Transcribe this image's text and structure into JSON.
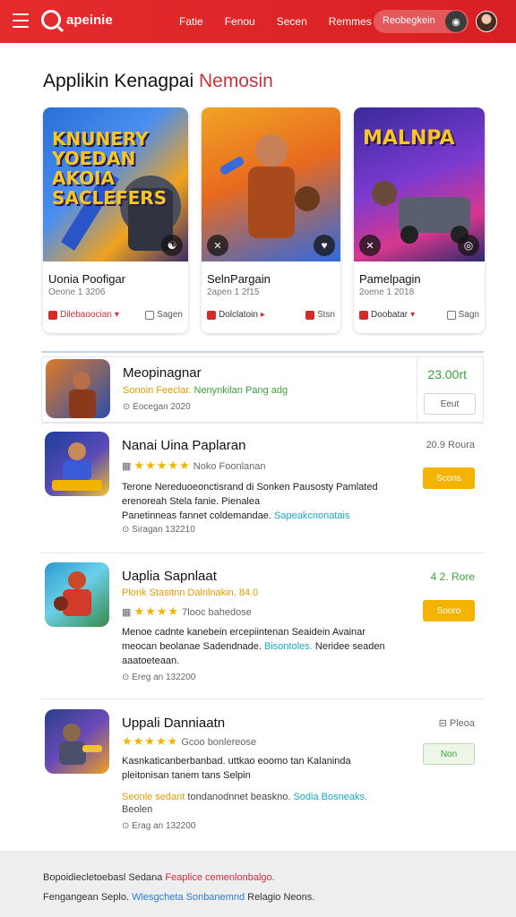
{
  "header": {
    "logo_text": "apeinie",
    "nav": [
      "Fatie",
      "Fenou",
      "Secen",
      "Remmes"
    ],
    "search_label": "Reobegkein",
    "search_icon": "chat-bubble-icon",
    "brand_color": "#e52b2b"
  },
  "section": {
    "title_main": "Applikin Kenagpai",
    "title_accent": "Nemosin"
  },
  "featured": [
    {
      "art_text": "KNUNERY YOEDAN AKOIA SACLEFERS",
      "title": "Uonia Poofigar",
      "subtitle": "Oeone 1 3206",
      "store": "Dilebaoocian",
      "save": "Sagen",
      "colors": [
        "#2a6fd6",
        "#f0a21f"
      ]
    },
    {
      "art_text": "",
      "title": "SelnPargain",
      "subtitle": "2apen 1 2f15",
      "store": "Dolclatoin",
      "save": "Stsn",
      "colors": [
        "#f08a24",
        "#3b6ed8"
      ]
    },
    {
      "art_text": "MALNPA",
      "title": "Pamelpagin",
      "subtitle": "2oene 1 2018",
      "store": "Doobatar",
      "save": "Sagn",
      "colors": [
        "#5a2ab8",
        "#d8378f"
      ]
    }
  ],
  "list": [
    {
      "title": "Meopinagnar",
      "meta_orange": "Sonoin Feeclar.",
      "meta_green": "Nenynkilan Pang adg",
      "footer": "Eocegan 2020",
      "price": "23.00rt",
      "button": "Eeut",
      "colors": [
        "#e07a2a",
        "#2a4fa8"
      ]
    },
    {
      "title": "Nanai Uina Paplaran",
      "stars": "★★★★★",
      "rating_text": "Noko Foonlanan",
      "desc_1": "Terone Nereduoeonctisrand di Sonken Pausosty Pamlated",
      "desc_2": "erenoreah Stela fanie. Pienalea",
      "desc_3": "Panetinneas fannet coldemandae.",
      "desc_link": "Sapeakcnonatais",
      "footer": "Siragan 132210",
      "price": "20.9 Roura",
      "button": "Scons",
      "colors": [
        "#1c3f9a",
        "#f2c230"
      ]
    },
    {
      "title": "Uaplia Sapnlaat",
      "meta_orange": "Plonk Stasitnn Dalnlnakin. 84.0",
      "stars": "★★★★",
      "rating_text": "7looc bahedose",
      "desc_1": "Menoe cadnte kanebein ercepiintenan Seaidein Avainar",
      "desc_2": "meocan beolanae Sadendnade.",
      "desc_link": "Bisontoles.",
      "desc_2b": "Neridee seaden",
      "desc_3": "aaatoeteaan.",
      "footer": "Ereg an 132200",
      "price": "4 2. Rore",
      "button": "Sooro",
      "colors": [
        "#2a9ad0",
        "#d23a2a"
      ]
    },
    {
      "title": "Uppali Danniaatn",
      "stars": "★★★★★",
      "rating_text": "Gcoo bonlereose",
      "desc_1": "Kasnkaticanberbanbad. uttkao eoomo tan Kalaninda",
      "desc_2": "pleitonisan tanem tans Selpin",
      "meta_orange": "Seonle sedant",
      "meta_grey": "tondanodnnet beaskno.",
      "desc_link": "Sodia Bosneaks.",
      "footer_top": "Beolen",
      "footer": "Erag an 132200",
      "price": "Pleoa",
      "button": "Non",
      "colors": [
        "#2a3f8a",
        "#f0a020"
      ]
    }
  ],
  "footer": {
    "line1_a": "Bopoidiecletoebasl Sedana",
    "line1_b": "Feaplice cemenlonbalgo.",
    "line2_a": "Fengangean Seplo.",
    "line2_b": "Wlesgcheta Sonbanemnd",
    "line2_c": "Relagio Neons."
  }
}
